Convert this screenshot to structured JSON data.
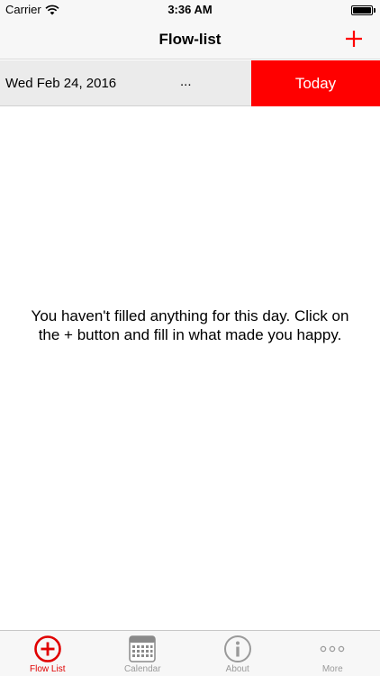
{
  "status": {
    "carrier": "Carrier",
    "time": "3:36 AM"
  },
  "nav": {
    "title": "Flow-list",
    "add_icon": "plus-icon"
  },
  "date_row": {
    "date": "Wed Feb 24, 2016",
    "more": "...",
    "today_label": "Today"
  },
  "empty_message": "You haven't filled anything for this day. Click on the + button and fill in what made you happy.",
  "tabs": [
    {
      "label": "Flow List",
      "icon": "add-circle-icon",
      "active": true
    },
    {
      "label": "Calendar",
      "icon": "calendar-icon",
      "active": false
    },
    {
      "label": "About",
      "icon": "info-icon",
      "active": false
    },
    {
      "label": "More",
      "icon": "more-icon",
      "active": false
    }
  ],
  "colors": {
    "accent": "#ff0000",
    "tab_inactive": "#9a9a9a",
    "bar_background": "#f7f7f7"
  }
}
